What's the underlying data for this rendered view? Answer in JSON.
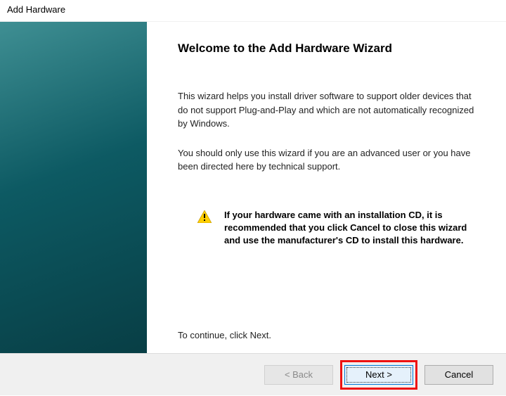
{
  "window": {
    "title": "Add Hardware"
  },
  "content": {
    "heading": "Welcome to the Add Hardware Wizard",
    "para1": "This wizard helps you install driver software to support older devices that do not support Plug-and-Play and which are not automatically recognized by Windows.",
    "para2": "You should only use this wizard if you are an advanced user or you have been directed here by technical support.",
    "notice": "If your hardware came with an installation CD, it is recommended that you click Cancel to close this wizard and use the manufacturer's CD to install this hardware.",
    "continue_hint": "To continue, click Next."
  },
  "buttons": {
    "back": "< Back",
    "next": "Next >",
    "cancel": "Cancel"
  }
}
